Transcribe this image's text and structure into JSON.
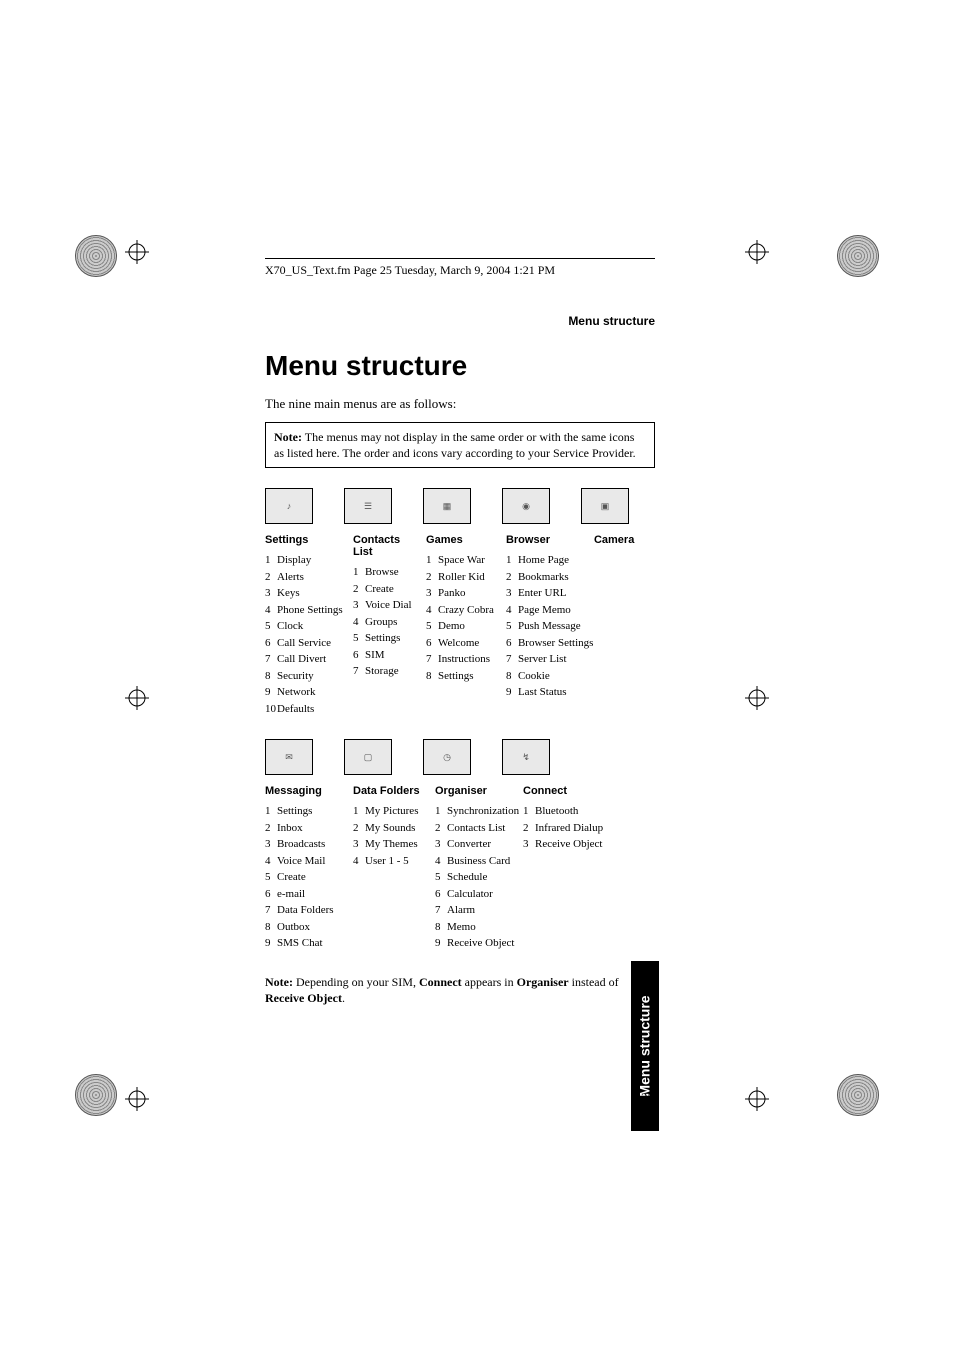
{
  "frame_header": "X70_US_Text.fm  Page 25  Tuesday, March 9, 2004  1:21 PM",
  "running_head": "Menu structure",
  "title": "Menu structure",
  "intro": "The nine main menus are as follows:",
  "note1_label": "Note:",
  "note1_body": "The menus may not display in the same order or with the same icons as listed here. The order and icons vary according to your Service Provider.",
  "row1": {
    "cols": [
      {
        "title": "Settings",
        "items": [
          "Display",
          "Alerts",
          "Keys",
          "Phone Settings",
          "Clock",
          "Call Service",
          "Call Divert",
          "Security",
          "Network",
          "Defaults"
        ]
      },
      {
        "title": "Contacts List",
        "items": [
          "Browse",
          "Create",
          "Voice Dial",
          "Groups",
          "Settings",
          "SIM",
          "Storage"
        ]
      },
      {
        "title": "Games",
        "items": [
          "Space War",
          "Roller Kid",
          "Panko",
          "Crazy Cobra",
          "Demo",
          "Welcome",
          "Instructions",
          "Settings"
        ]
      },
      {
        "title": "Browser",
        "items": [
          "Home Page",
          "Bookmarks",
          "Enter URL",
          "Page Memo",
          "Push Message",
          "Browser Settings",
          "Server List",
          "Cookie",
          "Last Status"
        ]
      },
      {
        "title": "Camera",
        "items": []
      }
    ]
  },
  "row2": {
    "cols": [
      {
        "title": "Messaging",
        "items": [
          "Settings",
          "Inbox",
          "Broadcasts",
          "Voice Mail",
          "Create",
          "e-mail",
          "Data Folders",
          "Outbox",
          "SMS Chat"
        ]
      },
      {
        "title": "Data Folders",
        "items": [
          "My Pictures",
          "My Sounds",
          "My Themes",
          "User 1 - 5"
        ]
      },
      {
        "title": "Organiser",
        "items": [
          "Synchronization",
          "Contacts List",
          "Converter",
          "Business Card",
          "Schedule",
          "Calculator",
          "Alarm",
          "Memo",
          "Receive Object"
        ]
      },
      {
        "title": "Connect",
        "items": [
          "Bluetooth",
          "Infrared Dialup",
          "Receive Object"
        ]
      }
    ]
  },
  "note2_label": "Note:",
  "note2_body_pre": "Depending on your SIM, ",
  "note2_b1": "Connect",
  "note2_mid1": " appears in ",
  "note2_b2": "Organiser",
  "note2_mid2": " instead of ",
  "note2_b3": "Receive Object",
  "note2_end": ".",
  "side_tab": "Menu structure",
  "page_number": "25",
  "icons_row1": [
    "audio",
    "list",
    "games",
    "globe",
    "camera"
  ],
  "icons_row2": [
    "msg",
    "folder",
    "clock",
    "connect",
    ""
  ]
}
